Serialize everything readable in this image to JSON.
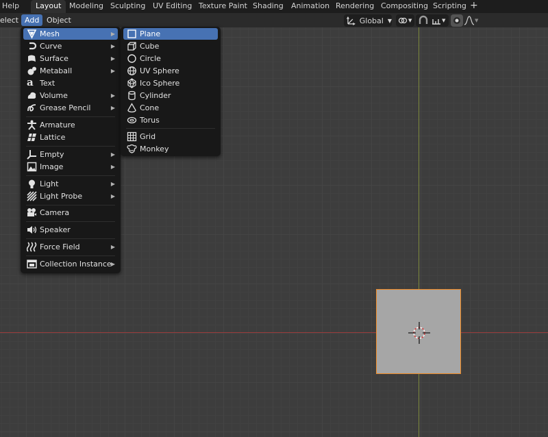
{
  "topbar": {
    "help": "Help",
    "tabs": [
      "Layout",
      "Modeling",
      "Sculpting",
      "UV Editing",
      "Texture Paint",
      "Shading",
      "Animation",
      "Rendering",
      "Compositing",
      "Scripting"
    ],
    "add_tab": "+"
  },
  "header": {
    "select_menu": "elect",
    "add_menu": "Add",
    "object_menu": "Object",
    "transform_orientation": "Global"
  },
  "add_menu": {
    "items": [
      "Mesh",
      "Curve",
      "Surface",
      "Metaball",
      "Text",
      "Volume",
      "Grease Pencil",
      "Armature",
      "Lattice",
      "Empty",
      "Image",
      "Light",
      "Light Probe",
      "Camera",
      "Speaker",
      "Force Field",
      "Collection Instance"
    ],
    "highlighted": "Mesh"
  },
  "mesh_submenu": {
    "items": [
      "Plane",
      "Cube",
      "Circle",
      "UV Sphere",
      "Ico Sphere",
      "Cylinder",
      "Cone",
      "Torus",
      "Grid",
      "Monkey"
    ],
    "highlighted": "Plane"
  },
  "colors": {
    "highlight": "#4772b3",
    "selection_outline": "#f08a24",
    "x_axis": "#9a3b3b",
    "y_axis": "#7d8a3e"
  }
}
